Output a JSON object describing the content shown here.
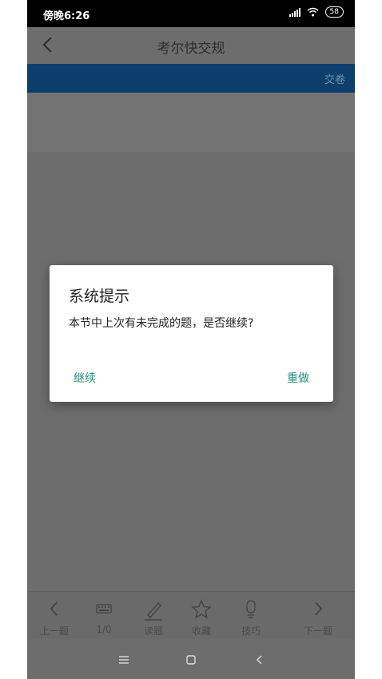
{
  "status_bar": {
    "time": "傍晚6:26",
    "battery": "58"
  },
  "header": {
    "title": "考尔快交规"
  },
  "bluebar": {
    "submit_label": "交卷"
  },
  "dialog": {
    "title": "系统提示",
    "message": "本节中上次有未完成的题，是否继续?",
    "continue_label": "继续",
    "redo_label": "重做"
  },
  "toolbar": {
    "items": [
      {
        "label": "上一题",
        "icon": "chevron-left-icon"
      },
      {
        "label": "1/0",
        "icon": "keyboard-icon"
      },
      {
        "label": "读题",
        "icon": "pencil-icon"
      },
      {
        "label": "收藏",
        "icon": "star-icon"
      },
      {
        "label": "技巧",
        "icon": "bulb-icon"
      },
      {
        "label": "下一题",
        "icon": "chevron-right-icon"
      }
    ]
  },
  "nav_bar": {
    "icons": [
      "menu-icon",
      "home-icon",
      "back-icon"
    ]
  },
  "colors": {
    "overlay_gray": "#6d6d6d",
    "accent_blue": "#0e3f6c",
    "dialog_button": "#2a8a80"
  }
}
